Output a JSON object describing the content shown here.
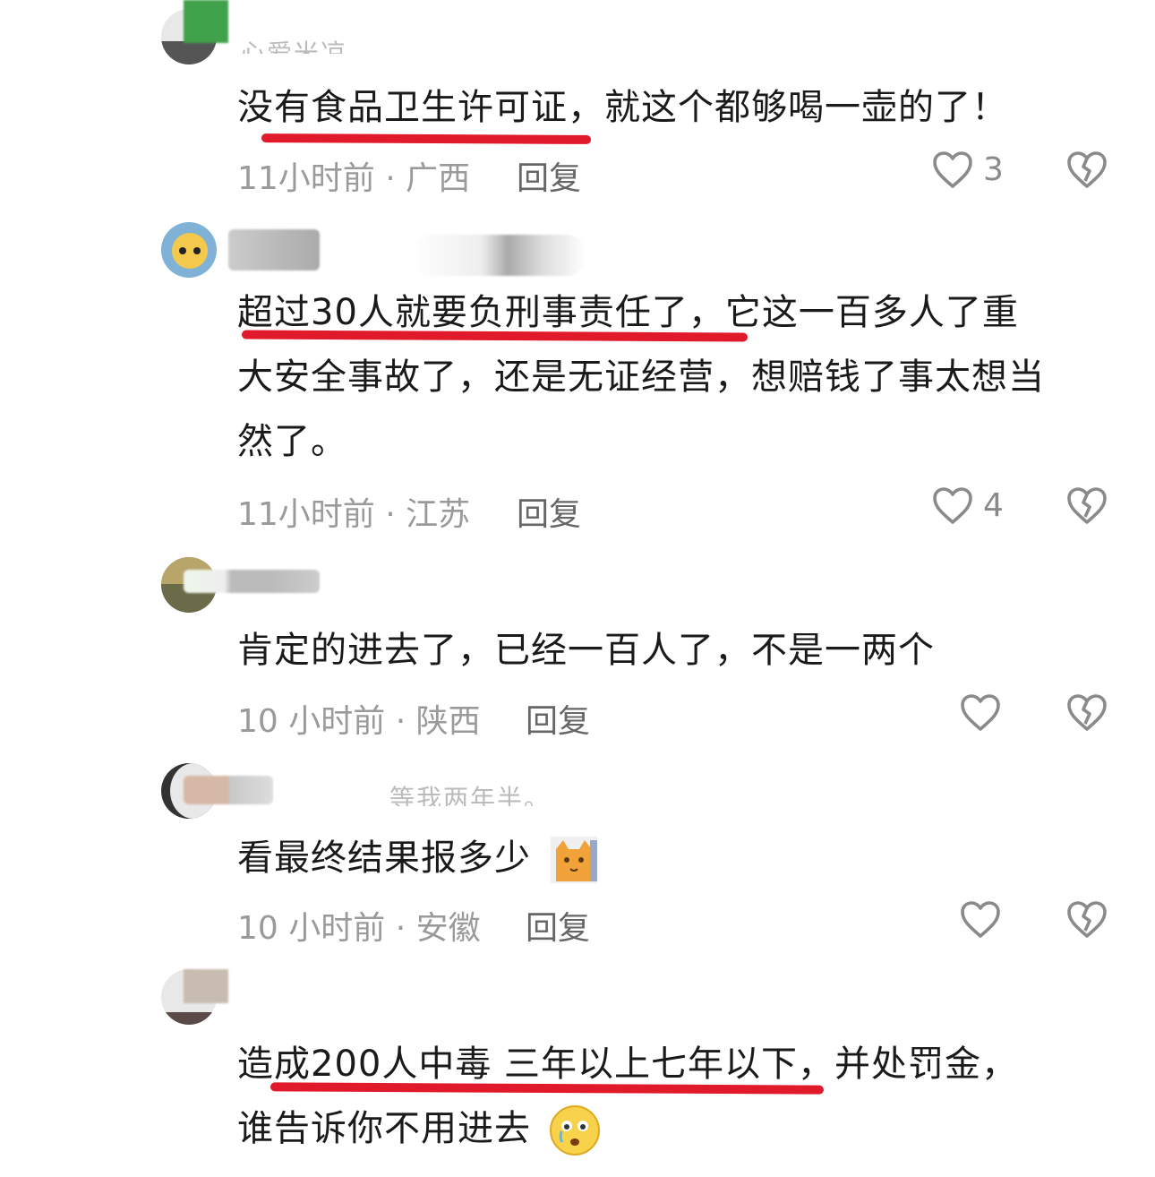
{
  "comments": [
    {
      "username": "心爱米凉",
      "text": "没有食品卫生许可证，就这个都够喝一壶的了！",
      "time_location": "11小时前 · 广西",
      "reply_label": "回复",
      "likes": "3"
    },
    {
      "username": "",
      "text_line1": "超过30人就要负刑事责任了，它这一百多人了重",
      "text_line2": "大安全事故了，还是无证经营，想赔钱了事太想当",
      "text_line3": "然了。",
      "time_location": "11小时前 · 江苏",
      "reply_label": "回复",
      "likes": "4"
    },
    {
      "username": "",
      "text": "肯定的进去了，已经一百人了，不是一两个",
      "time_location": "10 小时前 · 陕西",
      "reply_label": "回复",
      "likes": ""
    },
    {
      "username": "等我两年半。",
      "text": "看最终结果报多少",
      "emoji": "cat-face-emoji",
      "time_location": "10 小时前 · 安徽",
      "reply_label": "回复",
      "likes": ""
    },
    {
      "username": "",
      "text_line1": "造成200人中毒 三年以上七年以下，并处罚金，",
      "text_line2": "谁告诉你不用进去",
      "emoji": "crying-face-emoji"
    }
  ],
  "colors": {
    "underline": "#e01a2a",
    "meta": "#9a9a9a",
    "reply": "#666666"
  },
  "icons": {
    "like": "heart-outline-icon",
    "dislike": "broken-heart-icon"
  }
}
